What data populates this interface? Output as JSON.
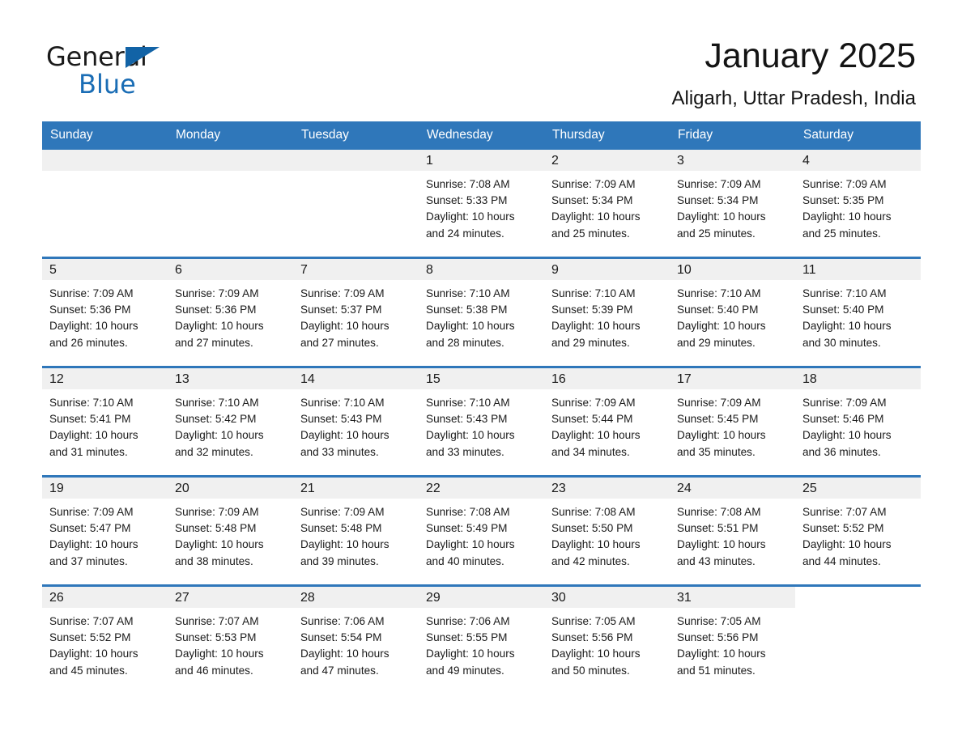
{
  "brand": {
    "name_part1": "General",
    "name_part2": "Blue",
    "flag_icon": "triangle-flag-icon"
  },
  "header": {
    "month_title": "January 2025",
    "location": "Aligarh, Uttar Pradesh, India"
  },
  "theme": {
    "header_blue": "#2f77ba",
    "brand_blue": "#1a6db5",
    "daynum_band": "#f0f0f0",
    "text": "#1a1a1a"
  },
  "weekday_headers": [
    "Sunday",
    "Monday",
    "Tuesday",
    "Wednesday",
    "Thursday",
    "Friday",
    "Saturday"
  ],
  "weeks": [
    [
      {
        "day": "",
        "sunrise": "",
        "sunset": "",
        "daylight_line1": "",
        "daylight_line2": "",
        "empty": true
      },
      {
        "day": "",
        "sunrise": "",
        "sunset": "",
        "daylight_line1": "",
        "daylight_line2": "",
        "empty": true
      },
      {
        "day": "",
        "sunrise": "",
        "sunset": "",
        "daylight_line1": "",
        "daylight_line2": "",
        "empty": true
      },
      {
        "day": "1",
        "sunrise": "Sunrise: 7:08 AM",
        "sunset": "Sunset: 5:33 PM",
        "daylight_line1": "Daylight: 10 hours",
        "daylight_line2": "and 24 minutes."
      },
      {
        "day": "2",
        "sunrise": "Sunrise: 7:09 AM",
        "sunset": "Sunset: 5:34 PM",
        "daylight_line1": "Daylight: 10 hours",
        "daylight_line2": "and 25 minutes."
      },
      {
        "day": "3",
        "sunrise": "Sunrise: 7:09 AM",
        "sunset": "Sunset: 5:34 PM",
        "daylight_line1": "Daylight: 10 hours",
        "daylight_line2": "and 25 minutes."
      },
      {
        "day": "4",
        "sunrise": "Sunrise: 7:09 AM",
        "sunset": "Sunset: 5:35 PM",
        "daylight_line1": "Daylight: 10 hours",
        "daylight_line2": "and 25 minutes."
      }
    ],
    [
      {
        "day": "5",
        "sunrise": "Sunrise: 7:09 AM",
        "sunset": "Sunset: 5:36 PM",
        "daylight_line1": "Daylight: 10 hours",
        "daylight_line2": "and 26 minutes."
      },
      {
        "day": "6",
        "sunrise": "Sunrise: 7:09 AM",
        "sunset": "Sunset: 5:36 PM",
        "daylight_line1": "Daylight: 10 hours",
        "daylight_line2": "and 27 minutes."
      },
      {
        "day": "7",
        "sunrise": "Sunrise: 7:09 AM",
        "sunset": "Sunset: 5:37 PM",
        "daylight_line1": "Daylight: 10 hours",
        "daylight_line2": "and 27 minutes."
      },
      {
        "day": "8",
        "sunrise": "Sunrise: 7:10 AM",
        "sunset": "Sunset: 5:38 PM",
        "daylight_line1": "Daylight: 10 hours",
        "daylight_line2": "and 28 minutes."
      },
      {
        "day": "9",
        "sunrise": "Sunrise: 7:10 AM",
        "sunset": "Sunset: 5:39 PM",
        "daylight_line1": "Daylight: 10 hours",
        "daylight_line2": "and 29 minutes."
      },
      {
        "day": "10",
        "sunrise": "Sunrise: 7:10 AM",
        "sunset": "Sunset: 5:40 PM",
        "daylight_line1": "Daylight: 10 hours",
        "daylight_line2": "and 29 minutes."
      },
      {
        "day": "11",
        "sunrise": "Sunrise: 7:10 AM",
        "sunset": "Sunset: 5:40 PM",
        "daylight_line1": "Daylight: 10 hours",
        "daylight_line2": "and 30 minutes."
      }
    ],
    [
      {
        "day": "12",
        "sunrise": "Sunrise: 7:10 AM",
        "sunset": "Sunset: 5:41 PM",
        "daylight_line1": "Daylight: 10 hours",
        "daylight_line2": "and 31 minutes."
      },
      {
        "day": "13",
        "sunrise": "Sunrise: 7:10 AM",
        "sunset": "Sunset: 5:42 PM",
        "daylight_line1": "Daylight: 10 hours",
        "daylight_line2": "and 32 minutes."
      },
      {
        "day": "14",
        "sunrise": "Sunrise: 7:10 AM",
        "sunset": "Sunset: 5:43 PM",
        "daylight_line1": "Daylight: 10 hours",
        "daylight_line2": "and 33 minutes."
      },
      {
        "day": "15",
        "sunrise": "Sunrise: 7:10 AM",
        "sunset": "Sunset: 5:43 PM",
        "daylight_line1": "Daylight: 10 hours",
        "daylight_line2": "and 33 minutes."
      },
      {
        "day": "16",
        "sunrise": "Sunrise: 7:09 AM",
        "sunset": "Sunset: 5:44 PM",
        "daylight_line1": "Daylight: 10 hours",
        "daylight_line2": "and 34 minutes."
      },
      {
        "day": "17",
        "sunrise": "Sunrise: 7:09 AM",
        "sunset": "Sunset: 5:45 PM",
        "daylight_line1": "Daylight: 10 hours",
        "daylight_line2": "and 35 minutes."
      },
      {
        "day": "18",
        "sunrise": "Sunrise: 7:09 AM",
        "sunset": "Sunset: 5:46 PM",
        "daylight_line1": "Daylight: 10 hours",
        "daylight_line2": "and 36 minutes."
      }
    ],
    [
      {
        "day": "19",
        "sunrise": "Sunrise: 7:09 AM",
        "sunset": "Sunset: 5:47 PM",
        "daylight_line1": "Daylight: 10 hours",
        "daylight_line2": "and 37 minutes."
      },
      {
        "day": "20",
        "sunrise": "Sunrise: 7:09 AM",
        "sunset": "Sunset: 5:48 PM",
        "daylight_line1": "Daylight: 10 hours",
        "daylight_line2": "and 38 minutes."
      },
      {
        "day": "21",
        "sunrise": "Sunrise: 7:09 AM",
        "sunset": "Sunset: 5:48 PM",
        "daylight_line1": "Daylight: 10 hours",
        "daylight_line2": "and 39 minutes."
      },
      {
        "day": "22",
        "sunrise": "Sunrise: 7:08 AM",
        "sunset": "Sunset: 5:49 PM",
        "daylight_line1": "Daylight: 10 hours",
        "daylight_line2": "and 40 minutes."
      },
      {
        "day": "23",
        "sunrise": "Sunrise: 7:08 AM",
        "sunset": "Sunset: 5:50 PM",
        "daylight_line1": "Daylight: 10 hours",
        "daylight_line2": "and 42 minutes."
      },
      {
        "day": "24",
        "sunrise": "Sunrise: 7:08 AM",
        "sunset": "Sunset: 5:51 PM",
        "daylight_line1": "Daylight: 10 hours",
        "daylight_line2": "and 43 minutes."
      },
      {
        "day": "25",
        "sunrise": "Sunrise: 7:07 AM",
        "sunset": "Sunset: 5:52 PM",
        "daylight_line1": "Daylight: 10 hours",
        "daylight_line2": "and 44 minutes."
      }
    ],
    [
      {
        "day": "26",
        "sunrise": "Sunrise: 7:07 AM",
        "sunset": "Sunset: 5:52 PM",
        "daylight_line1": "Daylight: 10 hours",
        "daylight_line2": "and 45 minutes."
      },
      {
        "day": "27",
        "sunrise": "Sunrise: 7:07 AM",
        "sunset": "Sunset: 5:53 PM",
        "daylight_line1": "Daylight: 10 hours",
        "daylight_line2": "and 46 minutes."
      },
      {
        "day": "28",
        "sunrise": "Sunrise: 7:06 AM",
        "sunset": "Sunset: 5:54 PM",
        "daylight_line1": "Daylight: 10 hours",
        "daylight_line2": "and 47 minutes."
      },
      {
        "day": "29",
        "sunrise": "Sunrise: 7:06 AM",
        "sunset": "Sunset: 5:55 PM",
        "daylight_line1": "Daylight: 10 hours",
        "daylight_line2": "and 49 minutes."
      },
      {
        "day": "30",
        "sunrise": "Sunrise: 7:05 AM",
        "sunset": "Sunset: 5:56 PM",
        "daylight_line1": "Daylight: 10 hours",
        "daylight_line2": "and 50 minutes."
      },
      {
        "day": "31",
        "sunrise": "Sunrise: 7:05 AM",
        "sunset": "Sunset: 5:56 PM",
        "daylight_line1": "Daylight: 10 hours",
        "daylight_line2": "and 51 minutes."
      },
      {
        "day": "",
        "sunrise": "",
        "sunset": "",
        "daylight_line1": "",
        "daylight_line2": "",
        "blank": true
      }
    ]
  ]
}
